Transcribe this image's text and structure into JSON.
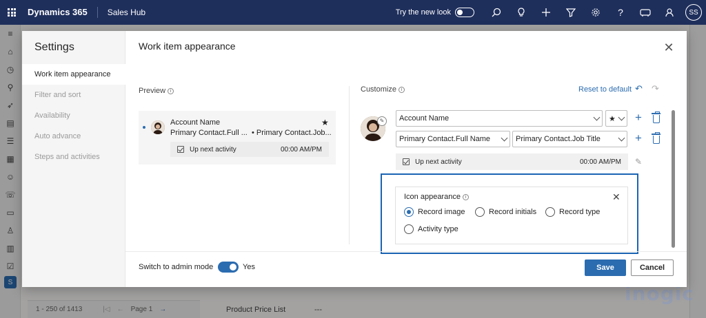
{
  "topbar": {
    "brand": "Dynamics 365",
    "app": "Sales Hub",
    "try_new_look": "Try the new look",
    "user_initials": "SS",
    "icons": [
      "search-icon",
      "lightbulb-icon",
      "plus-icon",
      "filter-icon",
      "gear-icon",
      "help-icon",
      "assist-icon",
      "copilot-icon"
    ]
  },
  "background": {
    "pagination": "1 - 250 of 1413",
    "page": "Page 1",
    "product_price_list_label": "Product Price List",
    "product_price_list_value": "---",
    "rail_badge": "S"
  },
  "dialog": {
    "nav_title": "Settings",
    "nav_items": [
      {
        "label": "Work item appearance",
        "active": true
      },
      {
        "label": "Filter and sort",
        "active": false
      },
      {
        "label": "Availability",
        "active": false
      },
      {
        "label": "Auto advance",
        "active": false
      },
      {
        "label": "Steps and activities",
        "active": false
      }
    ],
    "title": "Work item appearance",
    "preview": {
      "label": "Preview",
      "account_name": "Account Name",
      "star": "★",
      "contact_full": "Primary Contact.Full ...",
      "contact_job": "• Primary Contact.Job...",
      "activity": "Up next activity",
      "time": "00:00 AM/PM"
    },
    "customize": {
      "label": "Customize",
      "reset": "Reset to default",
      "field_1": "Account Name",
      "star_select": "★",
      "field_2": "Primary Contact.Full Name",
      "field_3": "Primary Contact.Job Title",
      "activity": "Up next activity",
      "time": "00:00 AM/PM"
    },
    "icon_appearance": {
      "title": "Icon appearance",
      "options": [
        {
          "label": "Record image",
          "checked": true
        },
        {
          "label": "Record initials",
          "checked": false
        },
        {
          "label": "Record type",
          "checked": false
        },
        {
          "label": "Activity type",
          "checked": false
        }
      ]
    },
    "footer": {
      "admin_mode_label": "Switch to admin mode",
      "admin_mode_value": "Yes",
      "save": "Save",
      "cancel": "Cancel"
    }
  },
  "watermark": "inogic",
  "colors": {
    "topbar": "#1f2f5c",
    "accent": "#2b6cb0",
    "highlight": "#1a63b3"
  }
}
